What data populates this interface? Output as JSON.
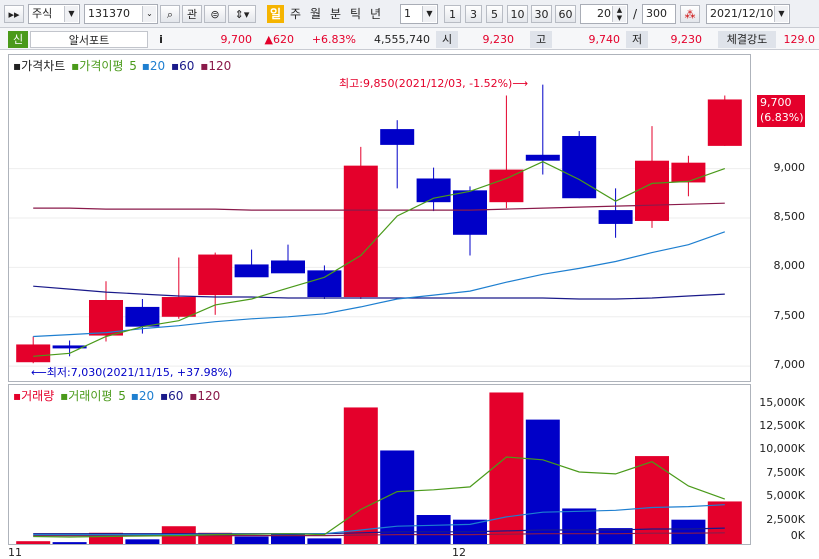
{
  "toolbar": {
    "market_select": "주식",
    "stock_code": "131370",
    "btn_search": "🔍",
    "btn_watch": "관",
    "period_active": "일",
    "periods": [
      "주",
      "월",
      "분",
      "틱",
      "년"
    ],
    "interval_select": "1",
    "intervals": [
      "1",
      "3",
      "5",
      "10",
      "30",
      "60"
    ],
    "count_value": "20",
    "count_sep": "/",
    "count_total": "300",
    "date_value": "2021/12/10"
  },
  "info": {
    "badge": "신",
    "stock_name": "알서포트",
    "info_icon": "i",
    "price": "9,700",
    "change": "▲620",
    "change_pct": "+6.83%",
    "volume": "4,555,740",
    "open_label": "시",
    "open": "9,230",
    "high_label": "고",
    "high": "9,740",
    "low_label": "저",
    "low": "9,230",
    "strength_label": "체결강도",
    "strength": "129.0"
  },
  "price_panel": {
    "legend_title": "가격차트",
    "legend_ma_title": "가격이평",
    "legend_ma": [
      "5",
      "20",
      "60",
      "120"
    ],
    "max_note": "최고:9,850(2021/12/03, -1.52%)⟶",
    "min_note": "⟵최저:7,030(2021/11/15, +37.98%)",
    "current_price_tag": "9,700",
    "current_pct_tag": "(6.83%)"
  },
  "volume_panel": {
    "legend_title": "거래량",
    "legend_ma_title": "거래이평",
    "legend_ma": [
      "5",
      "20",
      "60",
      "120"
    ]
  },
  "x_axis": {
    "labels": [
      "11",
      "12"
    ]
  },
  "colors": {
    "up": "#e4002b",
    "down": "#0000c8",
    "ma5": "#4a9a1a",
    "ma20": "#1e7fd0",
    "ma60": "#1a1a8a",
    "ma120": "#8a1a4a"
  },
  "chart_data": [
    {
      "type": "candlestick",
      "title": "가격차트",
      "ylim": [
        6850,
        10150
      ],
      "y_ticks": [
        "9,000",
        "8,500",
        "8,000",
        "7,500",
        "7,000"
      ],
      "y_tick_values": [
        9000,
        8500,
        8000,
        7500,
        7000
      ],
      "candles": [
        {
          "o": 7040,
          "h": 7300,
          "l": 7030,
          "c": 7220
        },
        {
          "o": 7210,
          "h": 7260,
          "l": 7100,
          "c": 7180
        },
        {
          "o": 7310,
          "h": 7860,
          "l": 7250,
          "c": 7670
        },
        {
          "o": 7600,
          "h": 7680,
          "l": 7330,
          "c": 7400
        },
        {
          "o": 7500,
          "h": 8100,
          "l": 7480,
          "c": 7700
        },
        {
          "o": 7720,
          "h": 8150,
          "l": 7520,
          "c": 8130
        },
        {
          "o": 8030,
          "h": 8180,
          "l": 7940,
          "c": 7900
        },
        {
          "o": 8070,
          "h": 8230,
          "l": 7970,
          "c": 7940
        },
        {
          "o": 7970,
          "h": 8020,
          "l": 7680,
          "c": 7700
        },
        {
          "o": 7700,
          "h": 9220,
          "l": 7680,
          "c": 9030
        },
        {
          "o": 9400,
          "h": 9490,
          "l": 8800,
          "c": 9240
        },
        {
          "o": 8900,
          "h": 9010,
          "l": 8570,
          "c": 8660
        },
        {
          "o": 8780,
          "h": 8820,
          "l": 8120,
          "c": 8330
        },
        {
          "o": 8660,
          "h": 9740,
          "l": 8600,
          "c": 8990
        },
        {
          "o": 9140,
          "h": 9850,
          "l": 8940,
          "c": 9080
        },
        {
          "o": 9330,
          "h": 9380,
          "l": 8700,
          "c": 8700
        },
        {
          "o": 8580,
          "h": 8800,
          "l": 8300,
          "c": 8440
        },
        {
          "o": 8470,
          "h": 9430,
          "l": 8400,
          "c": 9080
        },
        {
          "o": 8860,
          "h": 9130,
          "l": 8720,
          "c": 9060
        },
        {
          "o": 9230,
          "h": 9740,
          "l": 9230,
          "c": 9700
        }
      ],
      "ma5": [
        7100,
        7130,
        7300,
        7400,
        7460,
        7620,
        7680,
        7790,
        7900,
        8120,
        8520,
        8700,
        8770,
        8900,
        9070,
        8890,
        8670,
        8850,
        8870,
        9000
      ],
      "ma20": [
        7300,
        7320,
        7340,
        7380,
        7410,
        7450,
        7480,
        7500,
        7530,
        7600,
        7680,
        7720,
        7760,
        7850,
        7930,
        7990,
        8060,
        8150,
        8230,
        8360
      ],
      "ma60": [
        7810,
        7780,
        7750,
        7730,
        7710,
        7700,
        7700,
        7690,
        7690,
        7690,
        7690,
        7690,
        7690,
        7690,
        7690,
        7680,
        7680,
        7690,
        7710,
        7730
      ],
      "ma120": [
        8600,
        8600,
        8590,
        8590,
        8590,
        8590,
        8580,
        8580,
        8580,
        8580,
        8580,
        8580,
        8580,
        8590,
        8600,
        8610,
        8620,
        8630,
        8640,
        8650
      ]
    },
    {
      "type": "bar",
      "title": "거래량",
      "ylim": [
        0,
        17000
      ],
      "y_ticks": [
        "15,000K",
        "12,500K",
        "10,000K",
        "7,500K",
        "5,000K",
        "2,500K",
        "0K"
      ],
      "y_tick_values": [
        15000,
        12500,
        10000,
        7500,
        5000,
        2500,
        0
      ],
      "values": [
        300,
        200,
        1200,
        500,
        1900,
        1200,
        800,
        1100,
        600,
        14600,
        10000,
        3100,
        2600,
        16200,
        13300,
        3800,
        1700,
        9400,
        2600,
        4550
      ],
      "up": [
        true,
        false,
        true,
        false,
        true,
        true,
        false,
        false,
        false,
        true,
        false,
        false,
        false,
        true,
        false,
        false,
        false,
        true,
        false,
        true
      ],
      "ma5": [
        800,
        750,
        800,
        850,
        900,
        1000,
        1050,
        1100,
        1000,
        3700,
        5600,
        5800,
        6100,
        9300,
        9000,
        7700,
        7500,
        8800,
        6200,
        4800
      ],
      "ma20": [
        1000,
        1000,
        1000,
        1000,
        1000,
        1050,
        1050,
        1100,
        1100,
        1500,
        1900,
        2000,
        2100,
        2900,
        3400,
        3500,
        3600,
        3900,
        4000,
        4200
      ],
      "ma60": [
        1100,
        1100,
        1100,
        1100,
        1100,
        1100,
        1100,
        1100,
        1100,
        1200,
        1300,
        1300,
        1300,
        1400,
        1500,
        1500,
        1500,
        1600,
        1600,
        1700
      ],
      "ma120": [
        900,
        900,
        900,
        900,
        900,
        900,
        900,
        900,
        900,
        950,
        1000,
        1000,
        1000,
        1050,
        1100,
        1100,
        1100,
        1150,
        1150,
        1200
      ]
    }
  ]
}
